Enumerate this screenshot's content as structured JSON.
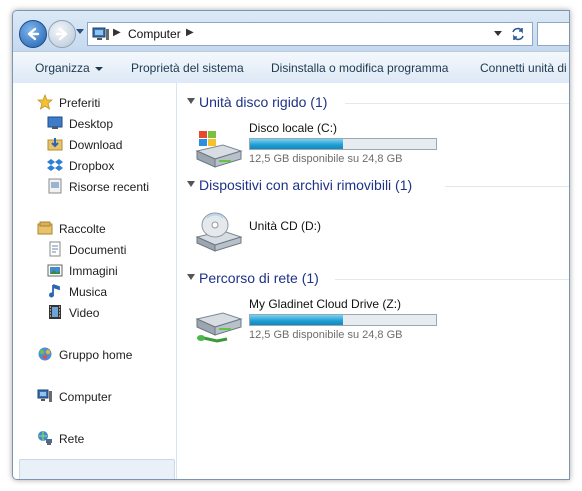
{
  "address": {
    "path": "Computer",
    "back_icon": "back-arrow-icon",
    "forward_icon": "forward-arrow-icon",
    "refresh_icon": "refresh-icon"
  },
  "toolbar": {
    "organize": "Organizza",
    "system_properties": "Proprietà del sistema",
    "uninstall": "Disinstalla o modifica programma",
    "map_drive": "Connetti unità di rete"
  },
  "sidebar": {
    "favorites": {
      "label": "Preferiti",
      "icon": "star-icon"
    },
    "favorites_items": [
      {
        "label": "Desktop",
        "icon": "desktop-icon"
      },
      {
        "label": "Download",
        "icon": "download-folder-icon"
      },
      {
        "label": "Dropbox",
        "icon": "dropbox-icon"
      },
      {
        "label": "Risorse recenti",
        "icon": "recent-places-icon"
      }
    ],
    "libraries": {
      "label": "Raccolte",
      "icon": "libraries-icon"
    },
    "libraries_items": [
      {
        "label": "Documenti",
        "icon": "documents-icon"
      },
      {
        "label": "Immagini",
        "icon": "pictures-icon"
      },
      {
        "label": "Musica",
        "icon": "music-icon"
      },
      {
        "label": "Video",
        "icon": "video-icon"
      }
    ],
    "homegroup": {
      "label": "Gruppo home",
      "icon": "homegroup-icon"
    },
    "computer": {
      "label": "Computer",
      "icon": "computer-icon"
    },
    "network": {
      "label": "Rete",
      "icon": "network-icon"
    }
  },
  "groups": [
    {
      "title": "Unità disco rigido (1)",
      "items": [
        {
          "name": "Disco locale (C:)",
          "free_text": "12,5 GB disponibile su 24,8 GB",
          "used_fraction": 0.5,
          "icon": "hard-drive-windows-icon"
        }
      ]
    },
    {
      "title": "Dispositivi con archivi rimovibili (1)",
      "items": [
        {
          "name": "Unità CD (D:)",
          "icon": "cd-drive-icon"
        }
      ]
    },
    {
      "title": "Percorso di rete (1)",
      "items": [
        {
          "name": "My Gladinet Cloud Drive (Z:)",
          "free_text": "12,5 GB disponibile su 24,8 GB",
          "used_fraction": 0.5,
          "icon": "network-drive-icon"
        }
      ]
    }
  ],
  "colors": {
    "group_title": "#1e3287",
    "usage_bar": "#1c9ed3",
    "selection": "#e9f0f8"
  }
}
